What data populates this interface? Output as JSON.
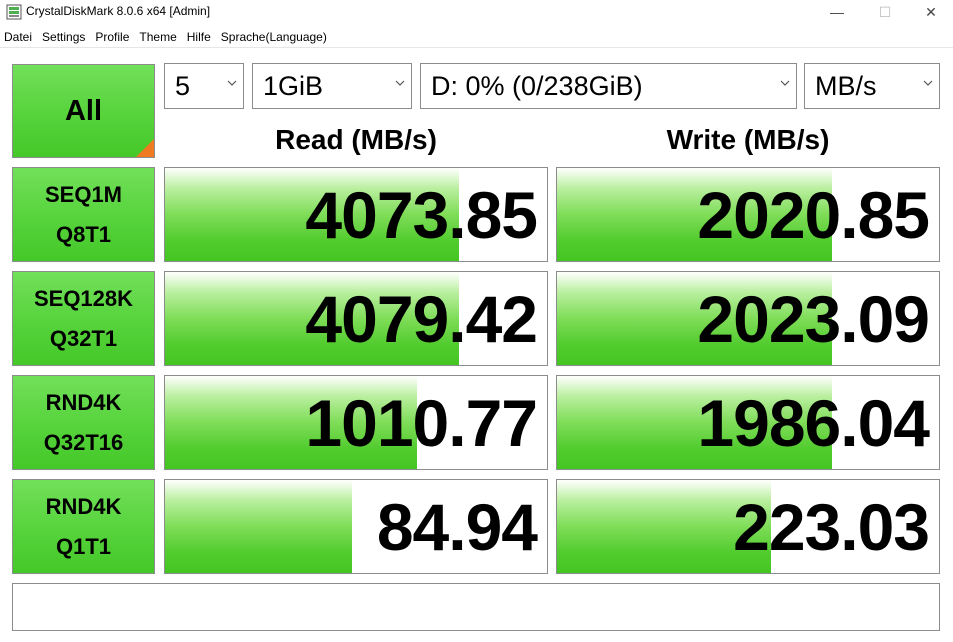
{
  "window": {
    "title": "CrystalDiskMark 8.0.6 x64 [Admin]",
    "minimize_glyph": "—",
    "maximize_glyph": "☐",
    "close_glyph": "✕"
  },
  "menu": [
    "Datei",
    "Settings",
    "Profile",
    "Theme",
    "Hilfe",
    "Sprache(Language)"
  ],
  "controls": {
    "all_label": "All",
    "count": "5",
    "size": "1GiB",
    "drive": "D: 0% (0/238GiB)",
    "unit": "MB/s"
  },
  "headers": {
    "read": "Read (MB/s)",
    "write": "Write (MB/s)"
  },
  "tests": [
    {
      "line1": "SEQ1M",
      "line2": "Q8T1",
      "read": "4073.85",
      "write": "2020.85",
      "read_fill": 0.77,
      "write_fill": 0.72
    },
    {
      "line1": "SEQ128K",
      "line2": "Q32T1",
      "read": "4079.42",
      "write": "2023.09",
      "read_fill": 0.77,
      "write_fill": 0.72
    },
    {
      "line1": "RND4K",
      "line2": "Q32T16",
      "read": "1010.77",
      "write": "1986.04",
      "read_fill": 0.66,
      "write_fill": 0.72
    },
    {
      "line1": "RND4K",
      "line2": "Q1T1",
      "read": "84.94",
      "write": "223.03",
      "read_fill": 0.49,
      "write_fill": 0.56
    }
  ],
  "colors": {
    "bar_green": "#52cc2f",
    "button_green": "#56d33b",
    "corner_orange": "#f07a22"
  },
  "comment": ""
}
